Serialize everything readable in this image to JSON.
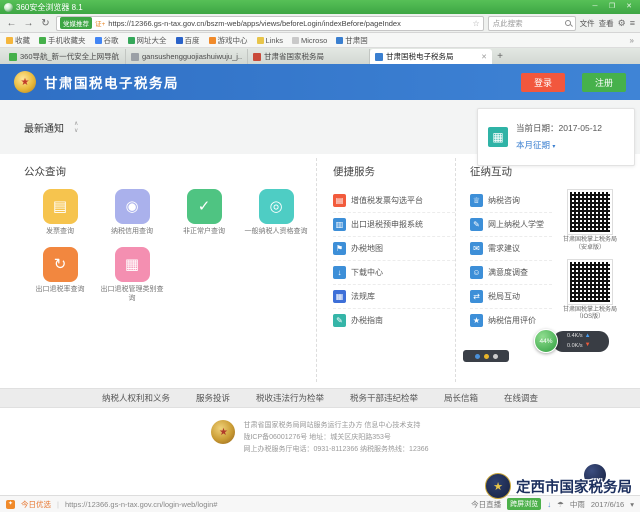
{
  "browser": {
    "titlebar": {
      "title": "360安全浏览器 8.1",
      "controls": {
        "minimize": "─",
        "maximize": "❐",
        "close": "✕"
      }
    },
    "toolbar": {
      "back": "←",
      "forward": "→",
      "refresh": "↻",
      "badge": "党媒推荐",
      "cert": "证+",
      "url": "https://12366.gs-n-tax.gov.cn/bszm-web/apps/views/beforeLogin/indexBefore/pageIndex",
      "star": "☆",
      "search_placeholder": "点此搜索",
      "menu_file": "文件",
      "menu_view": "查看",
      "menu_icon": "≡",
      "gear_icon": "⚙"
    },
    "bookmarks": [
      {
        "label": "收藏",
        "color": "#f5b63c"
      },
      {
        "label": "手机收藏夹",
        "color": "#45b04a"
      },
      {
        "label": "谷歌",
        "color": "#4285f4"
      },
      {
        "label": "网址大全",
        "color": "#35a85a"
      },
      {
        "label": "百度",
        "color": "#2a62c9"
      },
      {
        "label": "游戏中心",
        "color": "#f08a2a"
      },
      {
        "label": "Links",
        "color": "#e8c54a"
      },
      {
        "label": "Microso",
        "color": "#c9c9c9"
      },
      {
        "label": "甘肃国",
        "color": "#3a7fd0"
      }
    ],
    "tabs": [
      {
        "label": "360导航_新一代安全上网导航",
        "color": "#45b04a"
      },
      {
        "label": "gansushengguojiashuiwuju_j...",
        "color": "#9aa0a6"
      },
      {
        "label": "甘肃省国家税务局",
        "color": "#c94a3a"
      },
      {
        "label": "甘肃国税电子税务局",
        "color": "#3a7fd0"
      }
    ],
    "newtab": "+",
    "tab_close": "✕"
  },
  "site": {
    "header": {
      "title": "甘肃国税电子税务局",
      "login": "登录",
      "register": "注册"
    },
    "notice": {
      "label": "最新通知",
      "up": "∧",
      "down": "∨"
    },
    "date_panel": {
      "calendar_glyph": "▦",
      "date_label": "当前日期：",
      "date_value": "2017-05-12",
      "period_label": "本月征期",
      "caret": "▾"
    },
    "public_query": {
      "title": "公众查询",
      "items": [
        {
          "label": "发票查询",
          "color": "#f6c44e",
          "glyph": "▤"
        },
        {
          "label": "纳税信用查询",
          "color": "#aab1ec",
          "glyph": "◉"
        },
        {
          "label": "非正常户查询",
          "color": "#4fc482",
          "glyph": "✓"
        },
        {
          "label": "一般纳税人资格查询",
          "color": "#4ecdc4",
          "glyph": "◎"
        },
        {
          "label": "出口退税率查询",
          "color": "#f2873f",
          "glyph": "↻"
        },
        {
          "label": "出口退税管理类别查询",
          "color": "#f48fb1",
          "glyph": "▦"
        }
      ]
    },
    "convenient": {
      "title": "便捷服务",
      "items": [
        {
          "label": "增值税发票勾选平台",
          "color": "#f25b3c",
          "glyph": "▤"
        },
        {
          "label": "出口退税预申报系统",
          "color": "#3d8fd8",
          "glyph": "▥"
        },
        {
          "label": "办税地图",
          "color": "#3d8fd8",
          "glyph": "⚑"
        },
        {
          "label": "下载中心",
          "color": "#3d8fd8",
          "glyph": "↓"
        },
        {
          "label": "法规库",
          "color": "#3d6fd8",
          "glyph": "▦"
        },
        {
          "label": "办税指南",
          "color": "#35b5a8",
          "glyph": "✎"
        }
      ]
    },
    "interaction": {
      "title": "征纳互动",
      "items": [
        {
          "label": "纳税咨询",
          "color": "#3d8fd8",
          "glyph": "♕"
        },
        {
          "label": "网上纳税人学堂",
          "color": "#3d8fd8",
          "glyph": "✎"
        },
        {
          "label": "需求建议",
          "color": "#3d8fd8",
          "glyph": "✉"
        },
        {
          "label": "满意度调查",
          "color": "#3d8fd8",
          "glyph": "☺"
        },
        {
          "label": "税局互动",
          "color": "#3d8fd8",
          "glyph": "⇄"
        },
        {
          "label": "纳税信用评价",
          "color": "#3d8fd8",
          "glyph": "★"
        }
      ],
      "qr_codes": [
        {
          "label": "甘肃国税掌上税务局",
          "sublabel": "（安卓版）"
        },
        {
          "label": "甘肃国税掌上税务局",
          "sublabel": "（IOS版）"
        }
      ]
    },
    "footer_nav": [
      {
        "label": "纳税人权利和义务"
      },
      {
        "label": "服务投诉"
      },
      {
        "label": "税收违法行为检举"
      },
      {
        "label": "税务干部违纪检举"
      },
      {
        "label": "局长信箱"
      },
      {
        "label": "在线调查"
      }
    ],
    "footer": {
      "line1": "甘肃省国家税务局网站服务运行主办方  信息中心技术支持",
      "line2": "陇ICP备06001276号  地址：城关区庆阳路353号",
      "line3": "网上办税服务厅电话：0931-8112366  纳税服务热线：12366"
    }
  },
  "statusbar": {
    "promo": "今日优选",
    "url": "https://12366.gs-n-tax.gov.cn/login-web/login#",
    "live": "今日直播",
    "cross_screen": "跨屏浏览",
    "download_icon": "↓",
    "weather_icon": "☂",
    "weather": "中雨",
    "date": "2017/6/16",
    "caret": "▾"
  },
  "floating": {
    "speed_percent": "44%",
    "upload": "0.4K/s",
    "download": "0.0K/s",
    "up_arrow": "▲",
    "down_arrow": "▼",
    "watermark": "定西市国家税务局"
  }
}
